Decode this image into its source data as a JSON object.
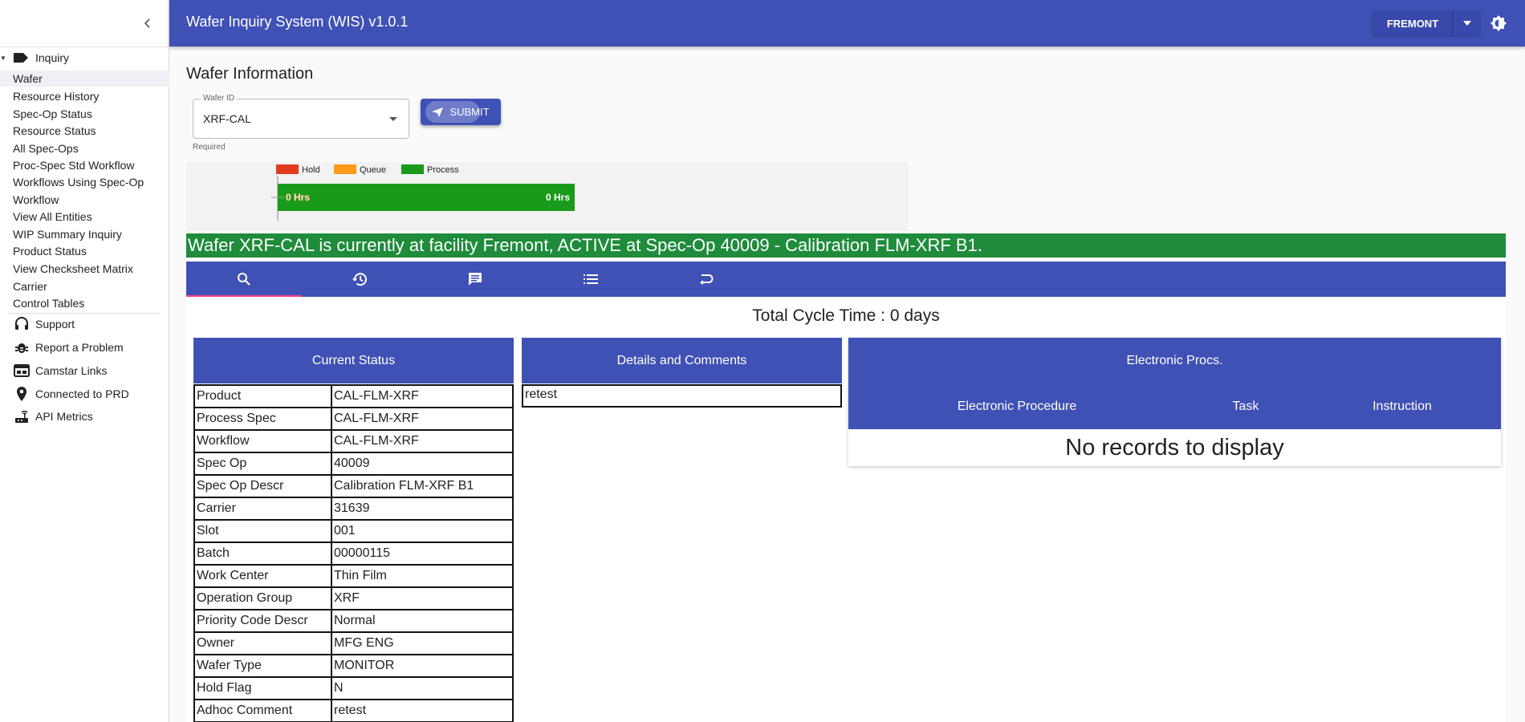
{
  "app": {
    "title": "Wafer Inquiry System (WIS) v1.0.1",
    "site": "FREMONT",
    "accent_color": "#3f51b5",
    "banner_color": "#1e8c3a"
  },
  "sidebar": {
    "group_label": "Inquiry",
    "group_icon": "label-icon",
    "items": [
      {
        "label": "Wafer",
        "active": true
      },
      {
        "label": "Resource History"
      },
      {
        "label": "Spec-Op Status"
      },
      {
        "label": "Resource Status"
      },
      {
        "label": "All Spec-Ops"
      },
      {
        "label": "Proc-Spec Std Workflow"
      },
      {
        "label": "Workflows Using Spec-Op"
      },
      {
        "label": "Workflow"
      },
      {
        "label": "View All Entities"
      },
      {
        "label": "WIP Summary Inquiry"
      },
      {
        "label": "Product Status"
      },
      {
        "label": "View Checksheet Matrix"
      },
      {
        "label": "Carrier"
      },
      {
        "label": "Control Tables"
      }
    ],
    "main_items": [
      {
        "label": "Support",
        "icon": "headset-icon"
      },
      {
        "label": "Report a Problem",
        "icon": "bug-icon"
      },
      {
        "label": "Camstar Links",
        "icon": "web-icon"
      },
      {
        "label": "Connected to PRD",
        "icon": "map-pin-icon"
      },
      {
        "label": "API Metrics",
        "icon": "router-icon"
      }
    ]
  },
  "page": {
    "title": "Wafer Information",
    "wafer_field_label": "Wafer ID",
    "wafer_field_value": "XRF-CAL",
    "required_hint": "Required",
    "submit_label": "SUBMIT"
  },
  "chart_data": {
    "type": "bar",
    "orientation": "horizontal",
    "legend": [
      {
        "name": "Hold",
        "color": "#e03c1f"
      },
      {
        "name": "Queue",
        "color": "#ff9c1a"
      },
      {
        "name": "Process",
        "color": "#1a9a1a"
      }
    ],
    "series": [
      {
        "name": "Hold",
        "values": [
          0
        ]
      },
      {
        "name": "Queue",
        "values": [
          0
        ]
      },
      {
        "name": "Process",
        "values": [
          0
        ]
      }
    ],
    "bar_labels": [
      "0 Hrs",
      "0 Hrs"
    ],
    "legend_position": "top-left"
  },
  "status_banner": "Wafer XRF-CAL is currently at facility Fremont, ACTIVE at Spec-Op 40009 - Calibration FLM-XRF B1.",
  "tabs": [
    {
      "icon": "search-icon",
      "active": true
    },
    {
      "icon": "history-icon"
    },
    {
      "icon": "comment-icon"
    },
    {
      "icon": "list-icon"
    },
    {
      "icon": "undo-icon"
    }
  ],
  "cycle_time": "Total Cycle Time : 0 days",
  "current_status": {
    "title": "Current Status",
    "rows": [
      {
        "key": "Product",
        "value": "CAL-FLM-XRF"
      },
      {
        "key": "Process Spec",
        "value": "CAL-FLM-XRF"
      },
      {
        "key": "Workflow",
        "value": "CAL-FLM-XRF"
      },
      {
        "key": "Spec Op",
        "value": "40009"
      },
      {
        "key": "Spec Op Descr",
        "value": "Calibration FLM-XRF B1"
      },
      {
        "key": "Carrier",
        "value": "31639"
      },
      {
        "key": "Slot",
        "value": "001"
      },
      {
        "key": "Batch",
        "value": "00000115"
      },
      {
        "key": "Work Center",
        "value": "Thin Film"
      },
      {
        "key": "Operation Group",
        "value": "XRF"
      },
      {
        "key": "Priority Code Descr",
        "value": "Normal"
      },
      {
        "key": "Owner",
        "value": "MFG ENG"
      },
      {
        "key": "Wafer Type",
        "value": "MONITOR"
      },
      {
        "key": "Hold Flag",
        "value": "N"
      },
      {
        "key": "Adhoc Comment",
        "value": "retest"
      }
    ]
  },
  "details": {
    "title": "Details and Comments",
    "comment": "retest"
  },
  "electronic_procs": {
    "title": "Electronic Procs.",
    "columns": [
      "Electronic Procedure",
      "Task",
      "Instruction"
    ],
    "empty_message": "No records to display"
  }
}
